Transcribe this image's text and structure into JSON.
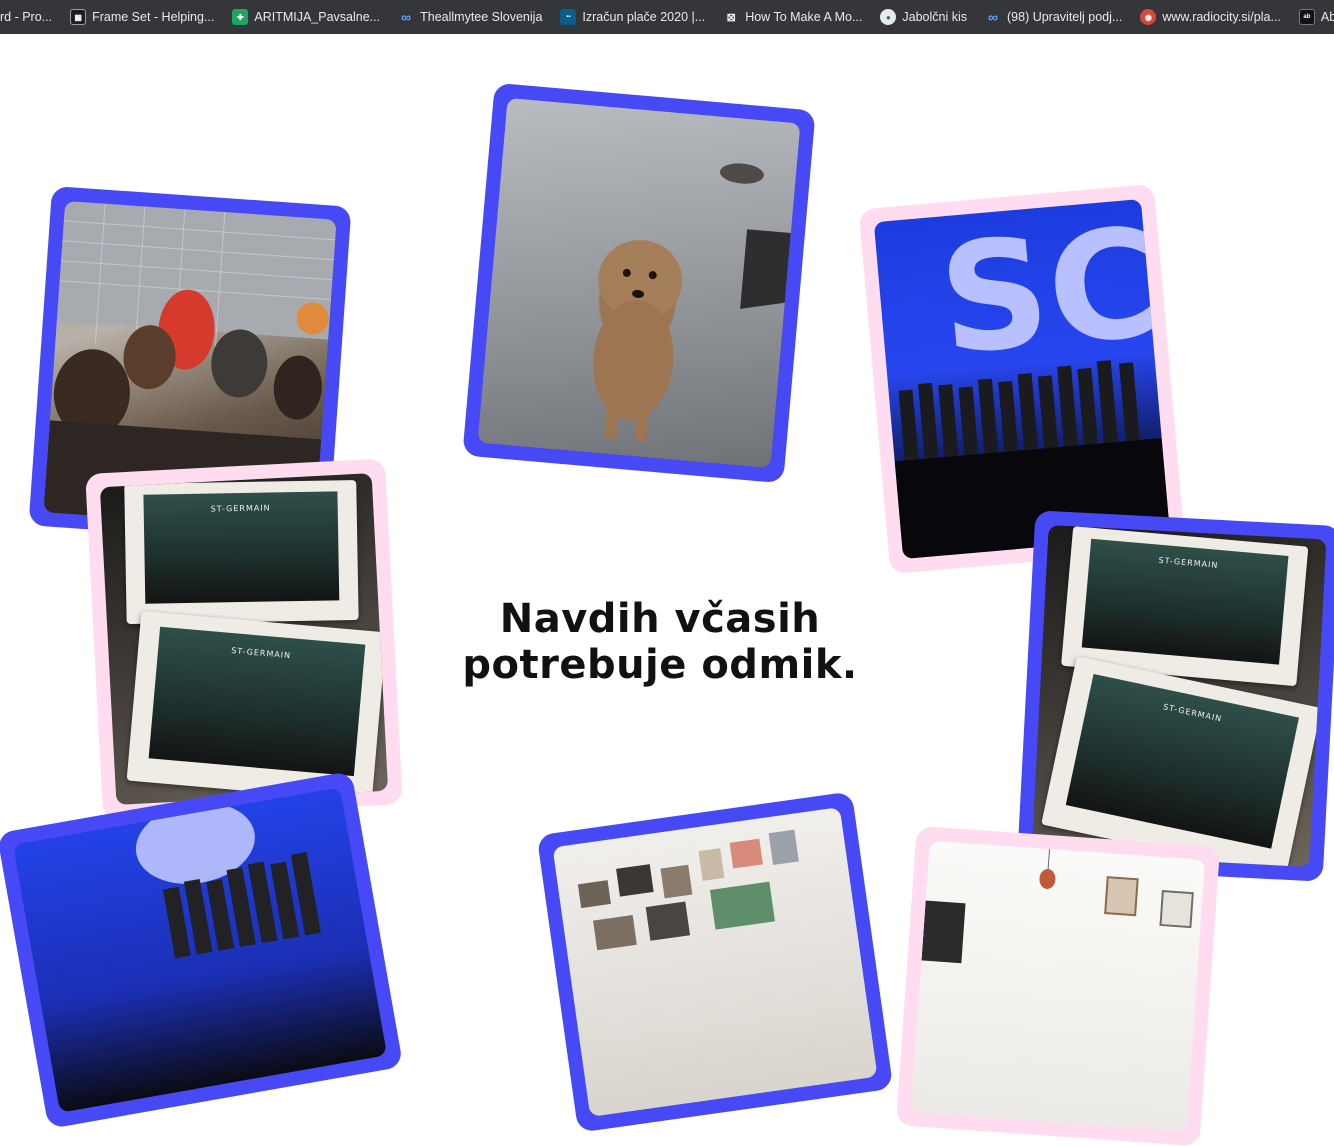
{
  "bookmarks": [
    {
      "label": "rd - Pro...",
      "icon": "none"
    },
    {
      "label": "Frame Set - Helping...",
      "icon": "frame-icon"
    },
    {
      "label": "ARITMIJA_Pavsalne...",
      "icon": "sheets-icon"
    },
    {
      "label": "Theallmytee Slovenija",
      "icon": "meta-icon"
    },
    {
      "label": "Izračun plače 2020 |...",
      "icon": "data-icon"
    },
    {
      "label": "How To Make A Mo...",
      "icon": "m-icon"
    },
    {
      "label": "Jabolčni kis",
      "icon": "apple-icon"
    },
    {
      "label": "(98) Upravitelj podj...",
      "icon": "meta-icon"
    },
    {
      "label": "www.radiocity.si/pla...",
      "icon": "radio-icon"
    },
    {
      "label": "Abduzeedo D",
      "icon": "abduzeedo-icon"
    }
  ],
  "headline": {
    "line1": "Navdih včasih",
    "line2": "potrebuje odmik."
  },
  "cards": {
    "stamp_label": "ST-GERMAIN",
    "stage_letters": "SC"
  },
  "colors": {
    "frame_blue": "#4649f5",
    "frame_pink": "#ffdcef",
    "bookmark_bar": "#35363a"
  }
}
